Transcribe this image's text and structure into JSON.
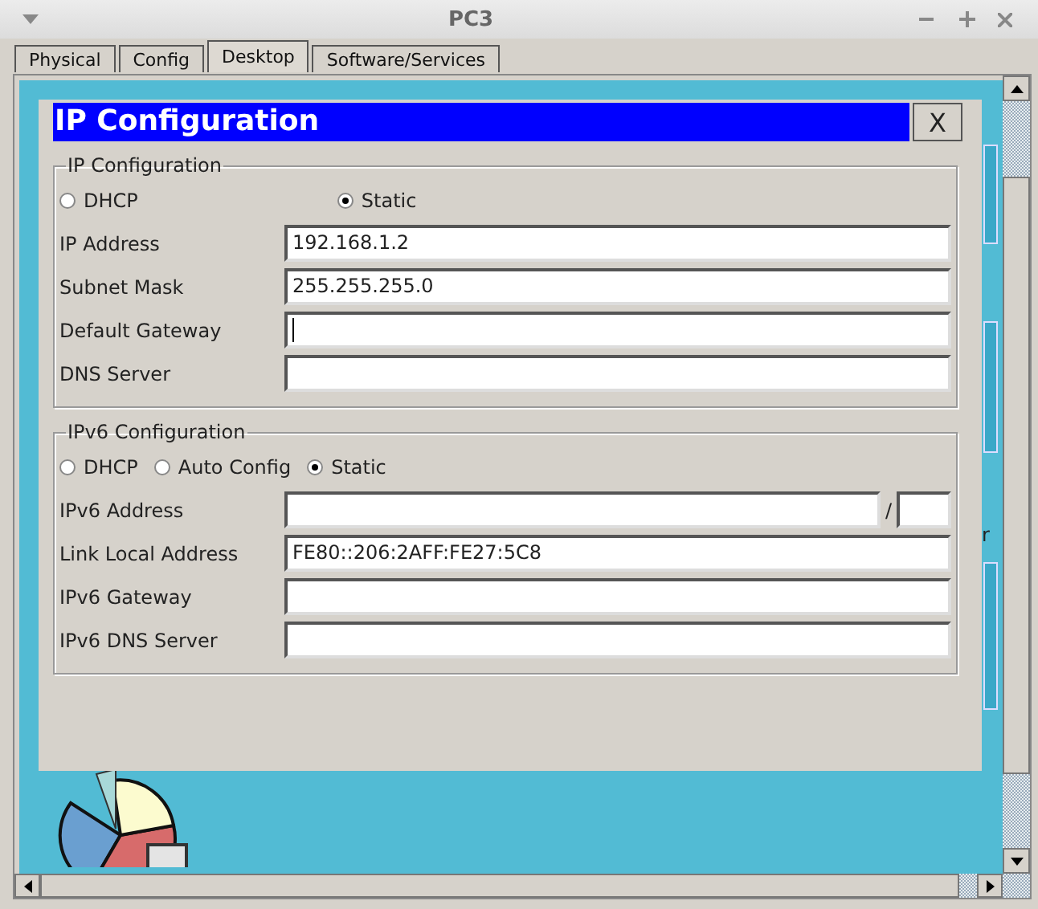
{
  "window": {
    "title": "PC3"
  },
  "tabs": [
    {
      "label": "Physical",
      "selected": false
    },
    {
      "label": "Config",
      "selected": false
    },
    {
      "label": "Desktop",
      "selected": true
    },
    {
      "label": "Software/Services",
      "selected": false
    }
  ],
  "desktop": {
    "cut_label": "r"
  },
  "dialog": {
    "title": "IP Configuration",
    "close": "X",
    "sections": [
      {
        "legend": "IP Configuration",
        "mode_options": [
          {
            "label": "DHCP",
            "selected": false
          },
          {
            "label": "Static",
            "selected": true
          }
        ],
        "fields": [
          {
            "kind": "plain",
            "label": "IP Address",
            "value": "192.168.1.2",
            "focused": false
          },
          {
            "kind": "plain",
            "label": "Subnet Mask",
            "value": "255.255.255.0",
            "focused": false
          },
          {
            "kind": "plain",
            "label": "Default Gateway",
            "focused": true
          },
          {
            "kind": "plain",
            "label": "DNS Server",
            "focused": false
          }
        ]
      },
      {
        "legend": "IPv6 Configuration",
        "mode_options": [
          {
            "label": "DHCP",
            "selected": false
          },
          {
            "label": "Auto Config",
            "selected": false
          },
          {
            "label": "Static",
            "selected": true
          }
        ],
        "fields": [
          {
            "kind": "prefixed",
            "label": "IPv6 Address",
            "separator": "/",
            "focused": false
          },
          {
            "kind": "plain",
            "label": "Link Local Address",
            "value": "FE80::206:2AFF:FE27:5C8",
            "focused": false
          },
          {
            "kind": "plain",
            "label": "IPv6 Gateway",
            "focused": false
          },
          {
            "kind": "plain",
            "label": "IPv6 DNS Server",
            "focused": false
          }
        ]
      }
    ]
  }
}
